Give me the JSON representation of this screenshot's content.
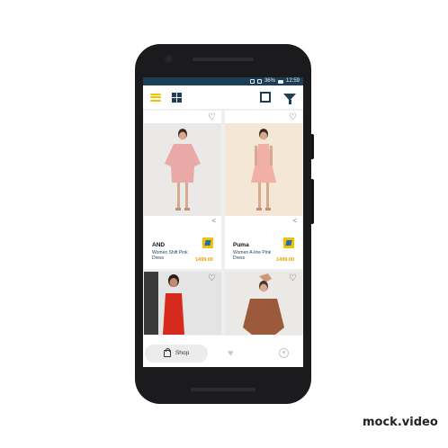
{
  "status_bar": {
    "battery": "36%",
    "time": "12:59"
  },
  "products": [
    {
      "brand": "AND",
      "name": "Women Shift Pink Dress",
      "price": "1499.00",
      "dress_color": "#e9a9a6"
    },
    {
      "brand": "Puma",
      "name": "Women A-line Pink Dress",
      "price": "1499.00",
      "dress_color": "#f0b0a6"
    },
    {
      "dress_color": "#d62a1d"
    },
    {
      "dress_color": "#9b5a3c"
    }
  ],
  "bottom_nav": {
    "shop_label": "Shop"
  },
  "watermark": "mock.video",
  "colors": {
    "accent": "#f2c200",
    "primary": "#1c3f57",
    "price": "#e3a300"
  },
  "icons": [
    "hamburger-icon",
    "grid-view-icon",
    "square-view-icon",
    "filter-icon",
    "heart-icon",
    "share-icon",
    "bag-icon",
    "user-icon"
  ]
}
